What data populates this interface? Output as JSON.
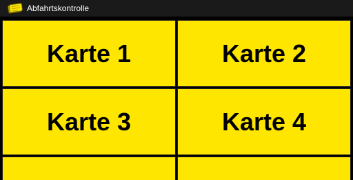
{
  "app": {
    "title": "Abfahrtskontrolle",
    "icon": "yellow-cards-icon",
    "accent_color": "#ffe600",
    "titlebar_color": "#1a1a1a"
  },
  "cards": [
    {
      "label": "Karte 1"
    },
    {
      "label": "Karte 2"
    },
    {
      "label": "Karte 3"
    },
    {
      "label": "Karte 4"
    },
    {
      "label": ""
    },
    {
      "label": ""
    }
  ]
}
